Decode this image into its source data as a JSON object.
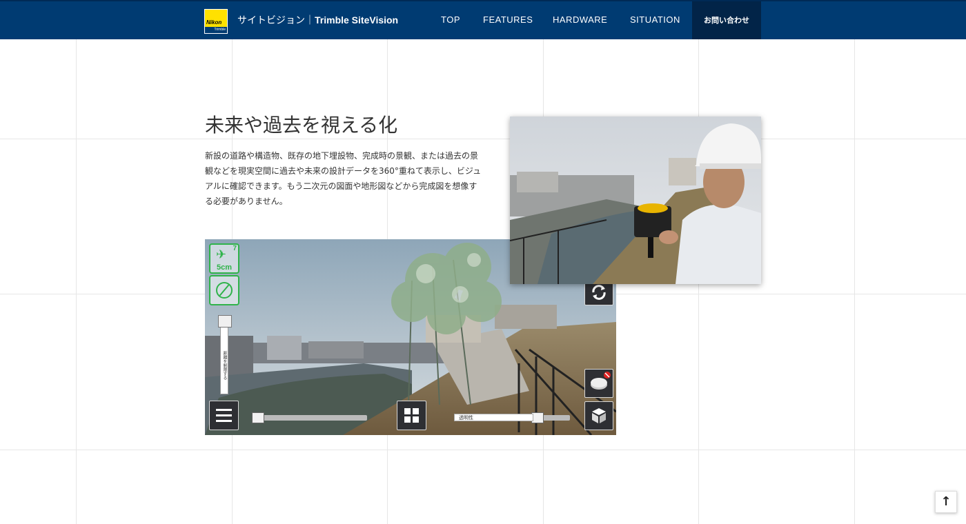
{
  "header": {
    "logo_top": "Nikon",
    "logo_bottom": "Trimble",
    "brand_jp": "サイトビジョン｜",
    "brand_en": "Trimble SiteVision",
    "nav": [
      "TOP",
      "FEATURES",
      "HARDWARE",
      "SITUATION"
    ],
    "contact": "お問い合わせ",
    "bg_color": "#003b72"
  },
  "section": {
    "heading": "未来や過去を視える化",
    "body": "新設の道路や構造物、既存の地下埋設物、完成時の景観、または過去の景観などを現実空間に過去や未来の設計データを360°重ねて表示し、ビジュアルに確認できます。もう二次元の図面や地形図などから完成図を想像する必要がありません。"
  },
  "app": {
    "satellites": "7",
    "accuracy": "5cm",
    "vertical_slider_label": "距離を制限する",
    "transparency_label": "透明性",
    "accent_color": "#2fb34a"
  },
  "back_to_top": "↑"
}
